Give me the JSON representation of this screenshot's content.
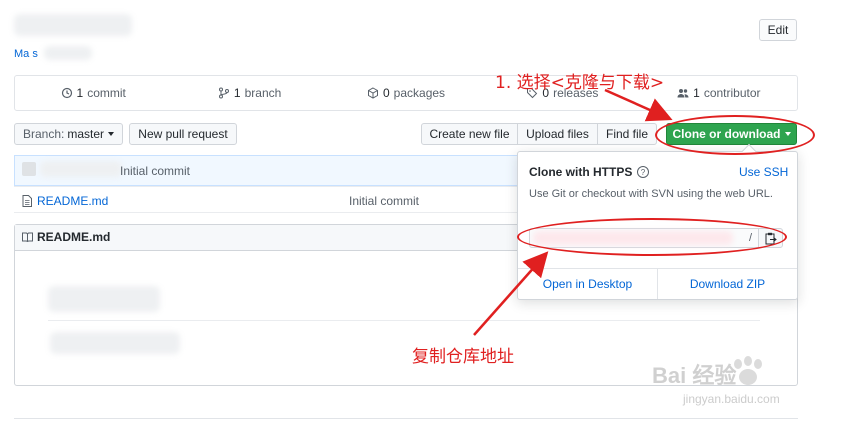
{
  "header": {
    "edit_label": "Edit",
    "topic_link": "Ma              s"
  },
  "summary": {
    "commits": "1",
    "commits_label": "commit",
    "branches": "1",
    "branches_label": "branch",
    "packages": "0",
    "packages_label": "packages",
    "releases": "0",
    "releases_label": "releases",
    "contributors": "1",
    "contributors_label": "contributor"
  },
  "toolbar": {
    "branch_prefix": "Branch:",
    "branch_name": "master",
    "new_pull_request": "New pull request",
    "create_new_file": "Create new file",
    "upload_files": "Upload files",
    "find_file": "Find file",
    "clone_or_download": "Clone or download"
  },
  "commit": {
    "message": "Initial commit"
  },
  "files": [
    {
      "name": "README.md",
      "message": "Initial commit"
    }
  ],
  "readme": {
    "title": "README.md"
  },
  "clone_popover": {
    "title": "Clone with HTTPS",
    "use_ssh": "Use SSH",
    "description": "Use Git or checkout with SVN using the web URL.",
    "url_tail": "/",
    "open_desktop": "Open in Desktop",
    "download_zip": "Download ZIP"
  },
  "annotations": {
    "step1": "1. 选择<克隆与下载>",
    "step2": "复制仓库地址",
    "color": "#e02020"
  },
  "watermark": {
    "brand": "Bai   经验",
    "url": "jingyan.baidu.com"
  },
  "colors": {
    "clone_green": "#2ea44f",
    "link_blue": "#0366d6"
  }
}
